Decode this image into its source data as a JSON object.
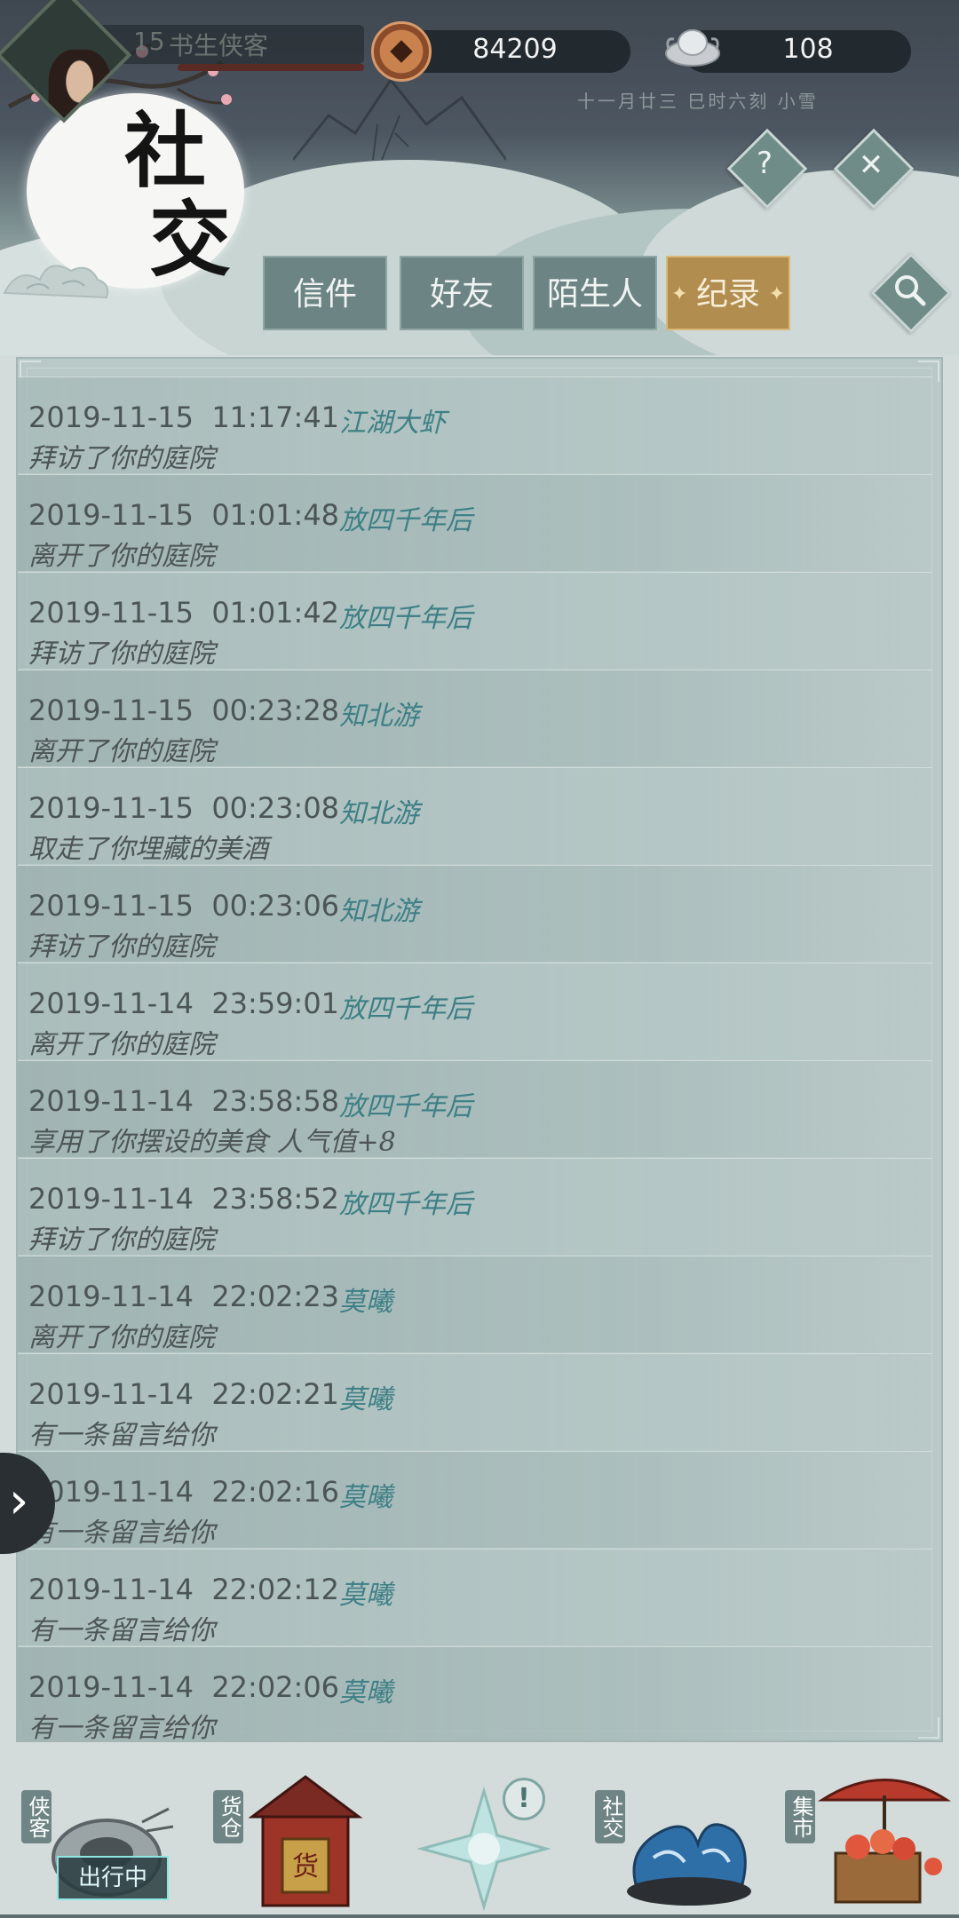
{
  "status_bar": {
    "level": "15",
    "player_name": "书生侠客",
    "copper": "84209",
    "silver": "108",
    "game_date": "十一月廿三  巳时六刻  小雪"
  },
  "page_title": "社交",
  "buttons": {
    "help": "?",
    "close": "✕",
    "search": "search-icon"
  },
  "tabs": [
    {
      "label": "信件",
      "active": false
    },
    {
      "label": "好友",
      "active": false
    },
    {
      "label": "陌生人",
      "active": false
    },
    {
      "label": "纪录",
      "active": true
    }
  ],
  "records": [
    {
      "time": "2019-11-15  11:17:41",
      "name": "江湖大虾",
      "action": "拜访了你的庭院"
    },
    {
      "time": "2019-11-15  01:01:48",
      "name": "放四千年后",
      "action": "离开了你的庭院"
    },
    {
      "time": "2019-11-15  01:01:42",
      "name": "放四千年后",
      "action": "拜访了你的庭院"
    },
    {
      "time": "2019-11-15  00:23:28",
      "name": "知北游",
      "action": "离开了你的庭院"
    },
    {
      "time": "2019-11-15  00:23:08",
      "name": "知北游",
      "action": "取走了你埋藏的美酒"
    },
    {
      "time": "2019-11-15  00:23:06",
      "name": "知北游",
      "action": "拜访了你的庭院"
    },
    {
      "time": "2019-11-14  23:59:01",
      "name": "放四千年后",
      "action": "离开了你的庭院"
    },
    {
      "time": "2019-11-14  23:58:58",
      "name": "放四千年后",
      "action": "享用了你摆设的美食 人气值+8"
    },
    {
      "time": "2019-11-14  23:58:52",
      "name": "放四千年后",
      "action": "拜访了你的庭院"
    },
    {
      "time": "2019-11-14  22:02:23",
      "name": "莫曦",
      "action": "离开了你的庭院"
    },
    {
      "time": "2019-11-14  22:02:21",
      "name": "莫曦",
      "action": "有一条留言给你"
    },
    {
      "time": "2019-11-14  22:02:16",
      "name": "莫曦",
      "action": "有一条留言给你"
    },
    {
      "time": "2019-11-14  22:02:12",
      "name": "莫曦",
      "action": "有一条留言给你"
    },
    {
      "time": "2019-11-14  22:02:06",
      "name": "莫曦",
      "action": "有一条留言给你"
    }
  ],
  "bottom_nav": [
    {
      "label": "侠客",
      "status": "出行中"
    },
    {
      "label": "货仓",
      "sign": "货"
    },
    {
      "label": "",
      "badge": "!"
    },
    {
      "label": "社交"
    },
    {
      "label": "集市"
    }
  ]
}
